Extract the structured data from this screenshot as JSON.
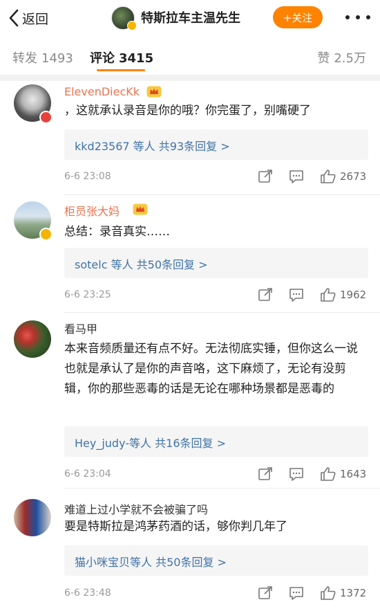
{
  "header": {
    "back_label": "返回",
    "title": "特斯拉车主温先生",
    "follow_label": "+关注"
  },
  "tabs": {
    "repost_label": "转发",
    "repost_count": "1493",
    "comments_label": "评论",
    "comments_count": "3415",
    "likes_label": "赞",
    "likes_count": "2.5万"
  },
  "colors": {
    "accent": "#ff8200",
    "username": "#eb7350",
    "link": "#3f73a8"
  },
  "comments": [
    {
      "name": "ElevenDiecKk",
      "text": "，这就承认录音是你的哦？你完蛋了，别嘴硬了",
      "replies": "kkd23567 等人 共93条回复 >",
      "time": "6-6 23:08",
      "likes": "2673"
    },
    {
      "name": "柜员张大妈",
      "text": "总结：录音真实……",
      "replies": "sotelc 等人 共50条回复 >",
      "time": "6-6 23:25",
      "likes": "1962"
    },
    {
      "name": "看马甲",
      "text": "本来音频质量还有点不好。无法彻底实锤，但你这么一说也就是承认了是你的声音咯，这下麻烦了，无论有没剪辑，你的那些恶毒的话是无论在哪种场景都是恶毒的",
      "replies": "Hey_judy-等人 共16条回复 >",
      "time": "6-6 23:04",
      "likes": "1643"
    },
    {
      "name": "难道上过小学就不会被骗了吗",
      "text": "要是特斯拉是鸿茅药酒的话，够你判几年了",
      "replies": "猫小咪宝贝等人 共50条回复 >",
      "time": "6-6 23:48",
      "likes": "1372"
    }
  ],
  "icons": {
    "back": "chevron-left-icon",
    "more": "more-dots-icon",
    "share": "share-icon",
    "comment": "comment-icon",
    "like": "thumbs-up-icon",
    "vip": "vip-crown-icon",
    "verified": "verified-badge-icon"
  }
}
